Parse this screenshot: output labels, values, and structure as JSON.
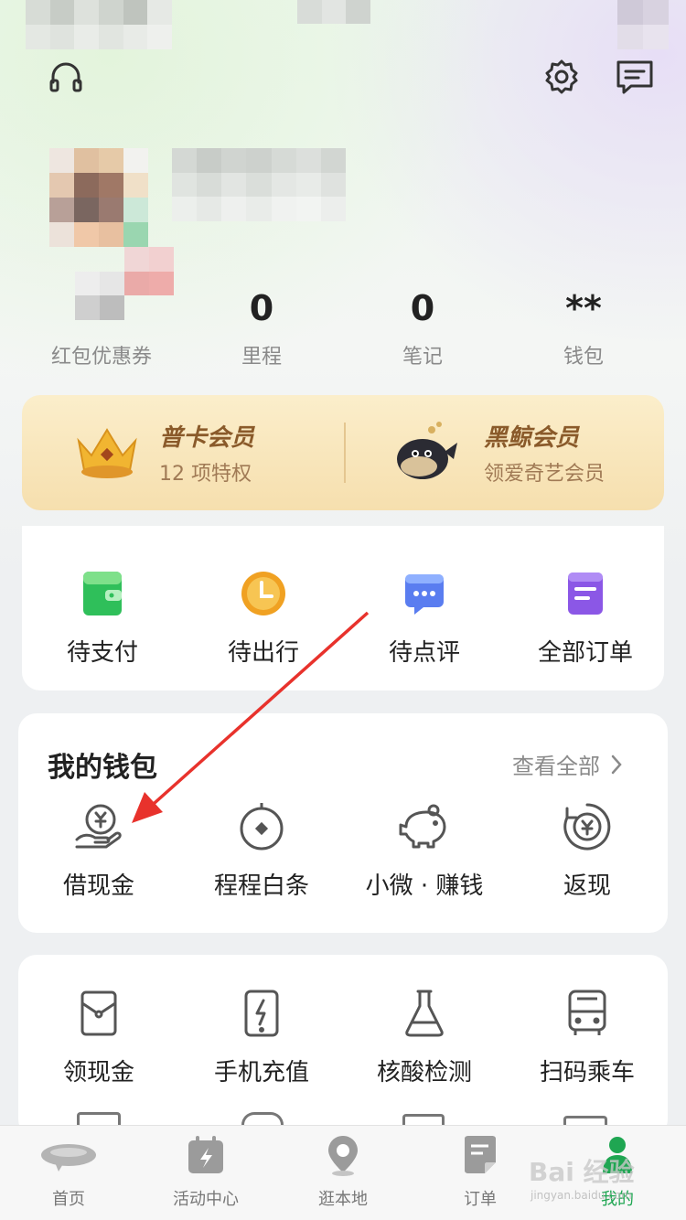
{
  "profile": {
    "stats": [
      {
        "value": "",
        "label": "红包优惠券"
      },
      {
        "value": "0",
        "label": "里程"
      },
      {
        "value": "0",
        "label": "笔记"
      },
      {
        "value": "**",
        "label": "钱包"
      }
    ]
  },
  "vip": {
    "left": {
      "title": "普卡会员",
      "subtitle": "12 项特权"
    },
    "right": {
      "title": "黑鲸会员",
      "subtitle": "领爱奇艺会员"
    }
  },
  "orders": {
    "items": [
      {
        "label": "待支付",
        "icon": "wallet-icon"
      },
      {
        "label": "待出行",
        "icon": "clock-icon"
      },
      {
        "label": "待点评",
        "icon": "chat-icon"
      },
      {
        "label": "全部订单",
        "icon": "list-icon"
      }
    ]
  },
  "wallet": {
    "title": "我的钱包",
    "see_all": "查看全部",
    "items": [
      {
        "label": "借现金",
        "icon": "cash-hand-icon"
      },
      {
        "label": "程程白条",
        "icon": "credit-icon"
      },
      {
        "label": "小微 · 赚钱",
        "icon": "piggy-bank-icon"
      },
      {
        "label": "返现",
        "icon": "cashback-icon"
      }
    ]
  },
  "services": {
    "items": [
      {
        "label": "领现金",
        "icon": "envelope-icon"
      },
      {
        "label": "手机充值",
        "icon": "phone-charge-icon"
      },
      {
        "label": "核酸检测",
        "icon": "flask-icon"
      },
      {
        "label": "扫码乘车",
        "icon": "bus-icon"
      }
    ]
  },
  "bottom_nav": {
    "items": [
      {
        "label": "首页",
        "icon": "home-icon"
      },
      {
        "label": "活动中心",
        "icon": "activity-icon"
      },
      {
        "label": "逛本地",
        "icon": "location-icon"
      },
      {
        "label": "订单",
        "icon": "order-icon"
      },
      {
        "label": "我的",
        "icon": "profile-icon"
      }
    ]
  },
  "watermark": {
    "brand": "Bai 经验",
    "url": "jingyan.baidu.com"
  },
  "colors": {
    "accent_green": "#1fa652",
    "vip_text": "#8a5a2a",
    "arrow_red": "#e8322c"
  }
}
